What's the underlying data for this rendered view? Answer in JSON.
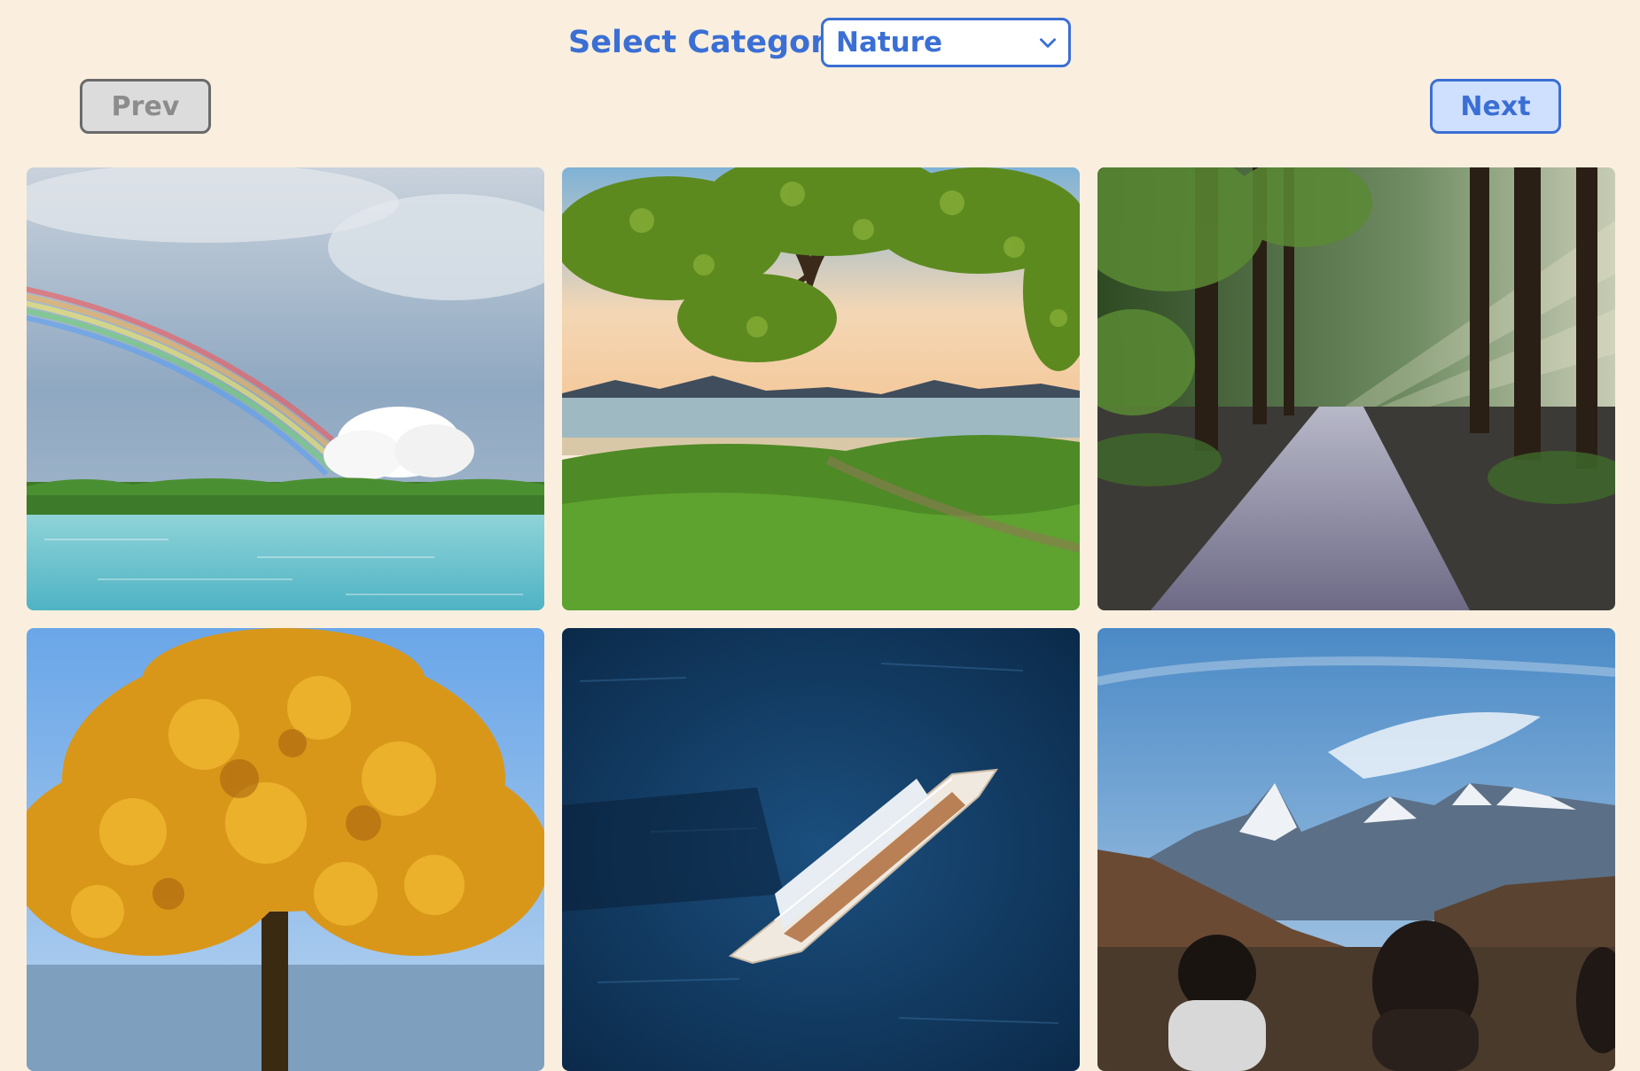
{
  "header": {
    "category_label": "Select Category:",
    "category_selected": "Nature",
    "category_chevron_icon": "chevron-down-icon"
  },
  "nav": {
    "prev_label": "Prev",
    "prev_enabled": false,
    "next_label": "Next",
    "next_enabled": true
  },
  "colors": {
    "background": "#faefde",
    "accent": "#3b6fd4",
    "disabled_button_bg": "#dcdcdc",
    "next_button_bg": "#cfe0ff"
  },
  "gallery": {
    "images": [
      {
        "subject": "rainbow over lake with trees"
      },
      {
        "subject": "tree branches over beach at sunset"
      },
      {
        "subject": "forest path with sunbeams"
      },
      {
        "subject": "golden autumn tree by water"
      },
      {
        "subject": "aerial view of sailboat on deep blue sea"
      },
      {
        "subject": "snowy mountain range with people in foreground"
      }
    ]
  }
}
